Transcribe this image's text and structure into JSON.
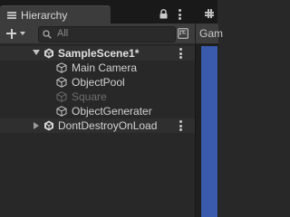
{
  "window": {
    "tab_title": "Hierarchy",
    "right_tab_title": "Gam"
  },
  "toolbar": {
    "search_placeholder": "All"
  },
  "hierarchy": {
    "scenes": [
      {
        "name": "SampleScene1*",
        "expanded": true,
        "children": [
          {
            "name": "Main Camera",
            "active": true
          },
          {
            "name": "ObjectPool",
            "active": true
          },
          {
            "name": "Square",
            "active": false
          },
          {
            "name": "ObjectGenerater",
            "active": true
          }
        ]
      },
      {
        "name": "DontDestroyOnLoad",
        "expanded": false,
        "children": []
      }
    ]
  },
  "colors": {
    "background": "#282828",
    "header": "#191919",
    "tab": "#3c3c3c",
    "scene_view_blue": "#3a5bab"
  }
}
